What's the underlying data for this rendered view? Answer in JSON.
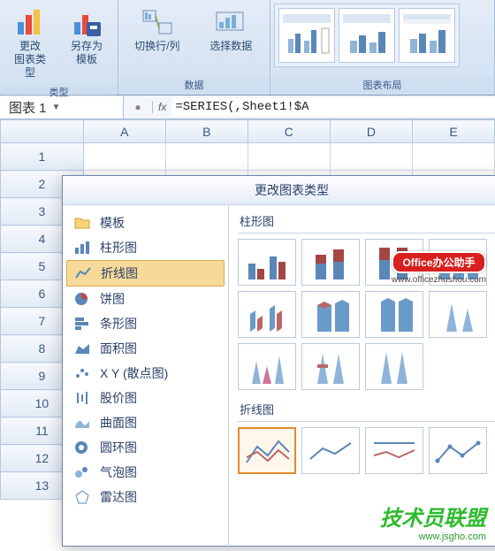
{
  "ribbon": {
    "groups": {
      "type": {
        "label": "类型",
        "change_chart_type": "更改\n图表类型",
        "save_template": "另存为\n模板"
      },
      "data": {
        "label": "数据",
        "switch_rc": "切换行/列",
        "select_data": "选择数据"
      },
      "layout": {
        "label": "图表布局"
      }
    }
  },
  "namebox": {
    "value": "图表 1"
  },
  "formula": {
    "fx": "fx",
    "value": "=SERIES(,Sheet1!$A"
  },
  "columns": [
    "A",
    "B",
    "C",
    "D",
    "E"
  ],
  "rows": [
    "1",
    "2",
    "3",
    "4",
    "5",
    "6",
    "7",
    "8",
    "9",
    "10",
    "11",
    "12",
    "13"
  ],
  "dialog": {
    "title": "更改图表类型",
    "side": [
      {
        "icon": "folder",
        "label": "模板"
      },
      {
        "icon": "bar",
        "label": "柱形图"
      },
      {
        "icon": "line",
        "label": "折线图",
        "selected": true
      },
      {
        "icon": "pie",
        "label": "饼图"
      },
      {
        "icon": "hbar",
        "label": "条形图"
      },
      {
        "icon": "area",
        "label": "面积图"
      },
      {
        "icon": "scatter",
        "label": "X Y (散点图)"
      },
      {
        "icon": "stock",
        "label": "股价图"
      },
      {
        "icon": "surface",
        "label": "曲面图"
      },
      {
        "icon": "donut",
        "label": "圆环图"
      },
      {
        "icon": "bubble",
        "label": "气泡图"
      },
      {
        "icon": "radar",
        "label": "雷达图"
      }
    ],
    "sections": {
      "column": "柱形图",
      "line": "折线图"
    }
  },
  "watermarks": {
    "office_helper": "Office办公助手",
    "office_url": "www.officezhushou.com",
    "jsylm": "技术员联盟",
    "jsylm_url": "www.jsgho.com"
  }
}
